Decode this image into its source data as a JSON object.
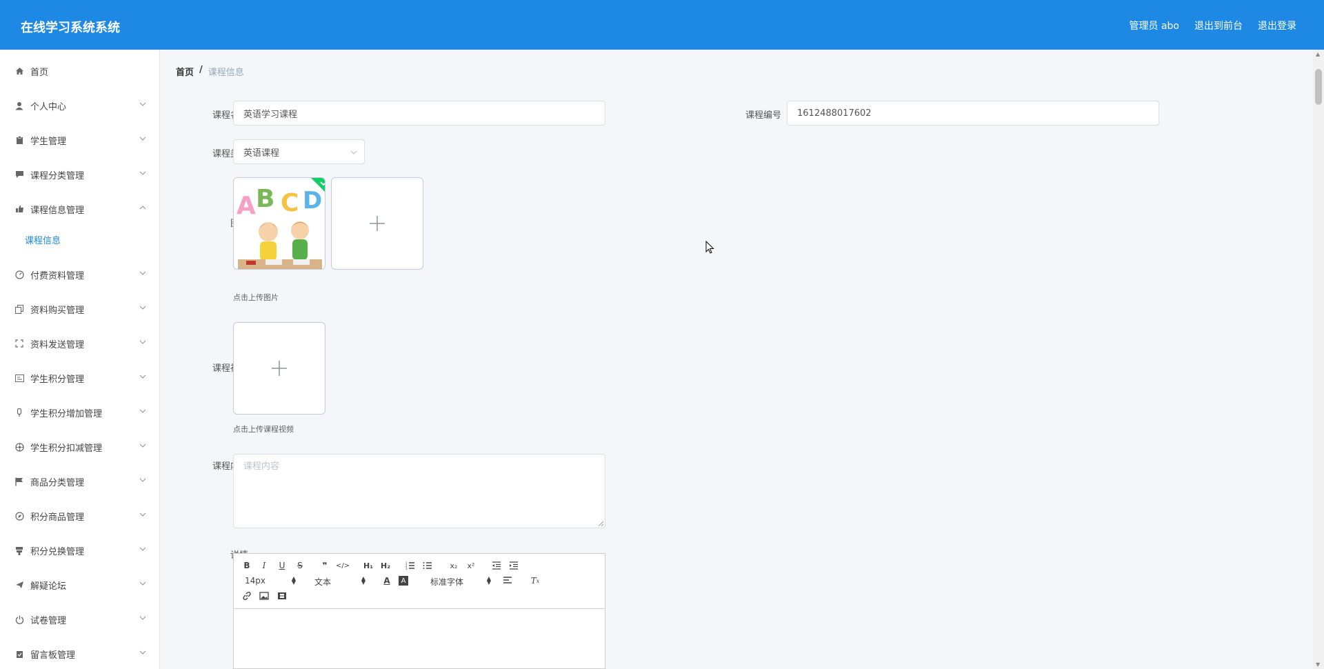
{
  "header": {
    "brand": "在线学习系统系统",
    "admin": "管理员 abo",
    "to_front": "退出到前台",
    "logout": "退出登录"
  },
  "sidebar": {
    "items": [
      {
        "label": "首页",
        "icon": "home-icon",
        "arrow": "none"
      },
      {
        "label": "个人中心",
        "icon": "user-icon",
        "arrow": "down"
      },
      {
        "label": "学生管理",
        "icon": "clipboard-icon",
        "arrow": "down"
      },
      {
        "label": "课程分类管理",
        "icon": "chat-icon",
        "arrow": "down"
      },
      {
        "label": "课程信息管理",
        "icon": "thumb-icon",
        "arrow": "up"
      },
      {
        "label": "付费资料管理",
        "icon": "gauge-icon",
        "arrow": "down"
      },
      {
        "label": "资料购买管理",
        "icon": "copy-icon",
        "arrow": "down"
      },
      {
        "label": "资料发送管理",
        "icon": "fullscreen-icon",
        "arrow": "down"
      },
      {
        "label": "学生积分管理",
        "icon": "card-icon",
        "arrow": "down"
      },
      {
        "label": "学生积分增加管理",
        "icon": "mic-icon",
        "arrow": "down"
      },
      {
        "label": "学生积分扣减管理",
        "icon": "settings-icon",
        "arrow": "down"
      },
      {
        "label": "商品分类管理",
        "icon": "flag-icon",
        "arrow": "down"
      },
      {
        "label": "积分商品管理",
        "icon": "compass-icon",
        "arrow": "down"
      },
      {
        "label": "积分兑换管理",
        "icon": "stamp-icon",
        "arrow": "down"
      },
      {
        "label": "解疑论坛",
        "icon": "send-icon",
        "arrow": "down"
      },
      {
        "label": "试卷管理",
        "icon": "power-icon",
        "arrow": "down"
      },
      {
        "label": "留言板管理",
        "icon": "clipboard-check-icon",
        "arrow": "down"
      }
    ],
    "sub_item": "课程信息"
  },
  "breadcrumb": {
    "home": "首页",
    "sep": "/",
    "current": "课程信息"
  },
  "form": {
    "name_label": "课程名称",
    "name_value": "英语学习课程",
    "code_label": "课程编号",
    "code_value": "1612488017602",
    "category_label": "课程类别",
    "category_value": "英语课程",
    "image_label": "图片",
    "image_tip": "点击上传图片",
    "video_label": "课程视频",
    "video_tip": "点击上传课程视频",
    "content_label": "课程内容",
    "content_placeholder": "课程内容",
    "detail_label": "详情"
  },
  "editor": {
    "font_size": "14px",
    "header_select": "文本",
    "font_family": "标准字体"
  },
  "image_letters": "ABCD",
  "colors": {
    "header": "#1e88e5",
    "accent": "#1e88e5",
    "success": "#13ce66"
  }
}
